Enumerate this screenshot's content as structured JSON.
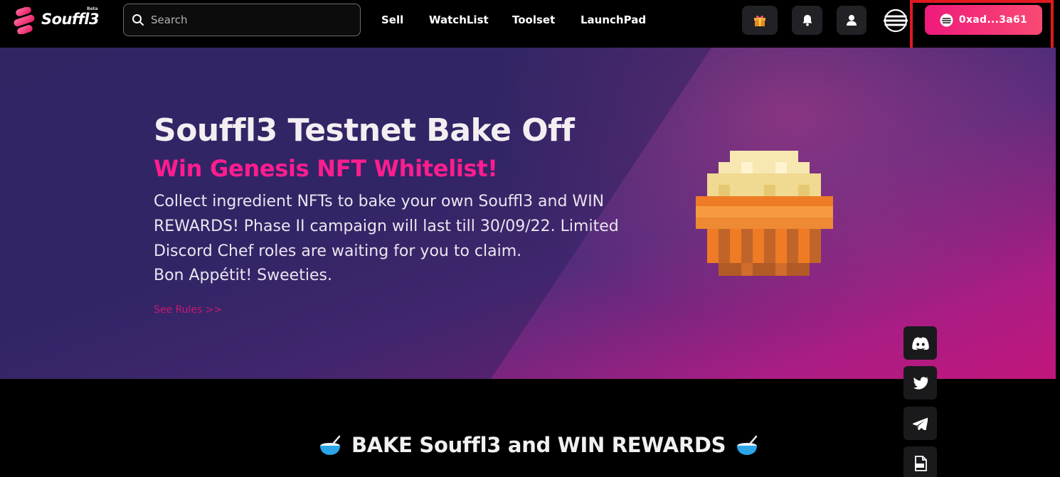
{
  "brand": {
    "name": "Souffl3",
    "tag": "Beta"
  },
  "search": {
    "placeholder": "Search"
  },
  "nav": {
    "links": [
      {
        "label": "Sell"
      },
      {
        "label": "WatchList"
      },
      {
        "label": "Toolset"
      },
      {
        "label": "LaunchPad"
      }
    ],
    "icons": [
      "gift-icon",
      "bell-icon",
      "user-icon",
      "menu-icon"
    ]
  },
  "wallet": {
    "address": "0xad...3a61"
  },
  "hero": {
    "title": "Souffl3 Testnet Bake Off",
    "subtitle": "Win Genesis NFT Whitelist!",
    "body": "Collect ingredient NFTs to bake your own Souffl3 and WIN REWARDS! Phase II campaign will last till 30/09/22. Limited Discord Chef roles are waiting for you to claim.",
    "sign_off": "Bon Appétit! Sweeties.",
    "rules_link": "See Rules >>"
  },
  "social": [
    "discord-icon",
    "twitter-icon",
    "telegram-icon",
    "docs-icon"
  ],
  "section": {
    "title": "BAKE Souffl3 and WIN REWARDS"
  },
  "colors": {
    "accent": "#ff1d8e",
    "wallet_gradient_start": "#ee1a7b",
    "wallet_gradient_end": "#fa4a74",
    "highlight": "#e1191f"
  }
}
